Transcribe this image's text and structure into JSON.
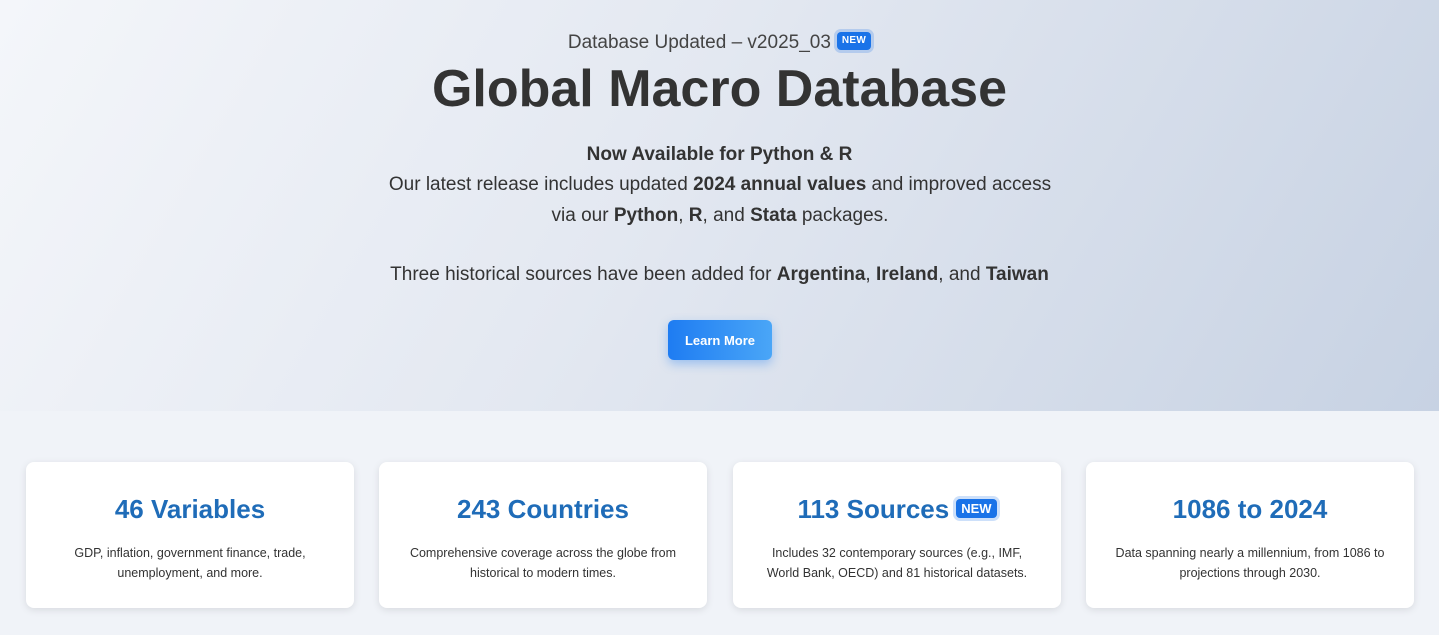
{
  "hero": {
    "update_prefix": "Database Updated – v2025_03",
    "update_badge": "NEW",
    "title": "Global Macro Database",
    "subtitle": "Now Available for Python & R",
    "desc": {
      "t1": "Our latest release includes updated ",
      "b1": "2024 annual values",
      "t2": " and improved access via our ",
      "b2": "Python",
      "t3": ", ",
      "b3": "R",
      "t4": ", and ",
      "b4": "Stata",
      "t5": " packages."
    },
    "added": {
      "t1": "Three historical sources have been added for ",
      "b1": "Argentina",
      "t2": ", ",
      "b2": "Ireland",
      "t3": ", and ",
      "b3": "Taiwan"
    },
    "button_label": "Learn More"
  },
  "stats": [
    {
      "title": "46 Variables",
      "badge": "",
      "text": "GDP, inflation, government finance, trade, unemployment, and more."
    },
    {
      "title": "243 Countries",
      "badge": "",
      "text": "Comprehensive coverage across the globe from historical to modern times."
    },
    {
      "title": "113 Sources",
      "badge": "NEW",
      "text": "Includes 32 contemporary sources (e.g., IMF, World Bank, OECD) and 81 historical datasets."
    },
    {
      "title": "1086 to 2024",
      "badge": "",
      "text": "Data spanning nearly a millennium, from 1086 to projections through 2030."
    }
  ],
  "colors": {
    "accent": "#1a73e8",
    "stat_title": "#1f6cb8",
    "text": "#333333"
  }
}
